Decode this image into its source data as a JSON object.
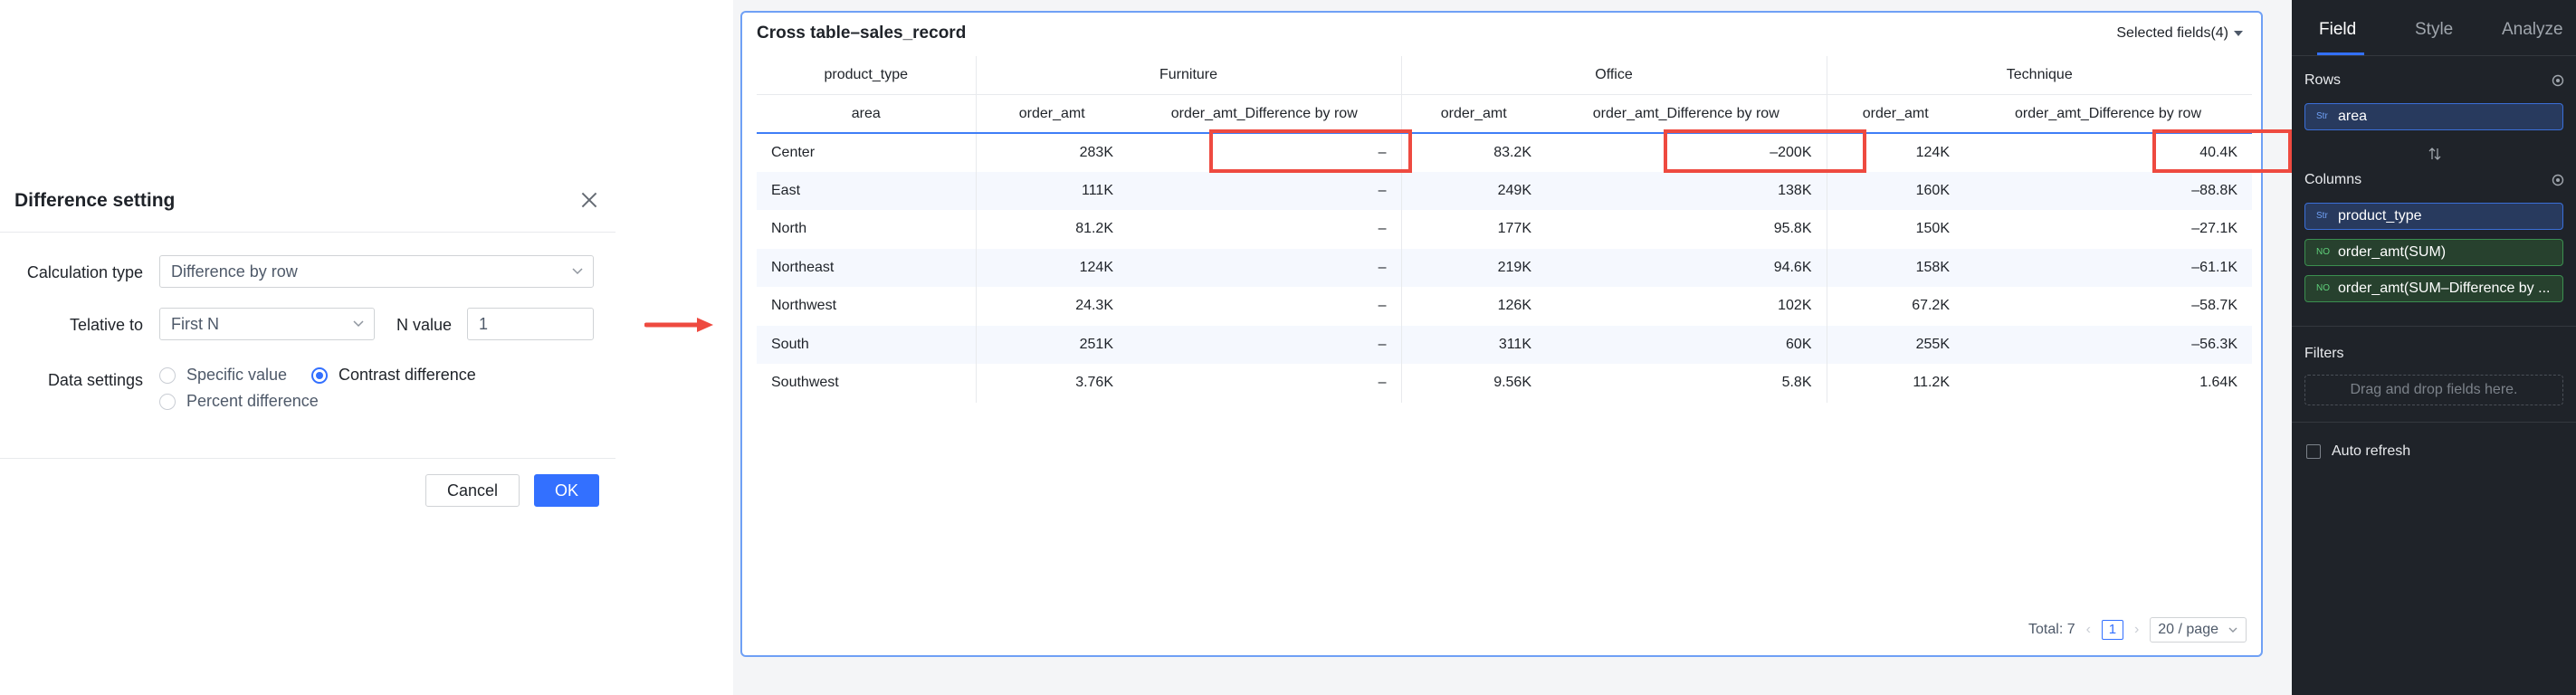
{
  "dialog": {
    "title": "Difference setting",
    "calc_type_label": "Calculation type",
    "calc_type_value": "Difference by row",
    "relative_label": "Telative to",
    "relative_value": "First N",
    "n_label": "N value",
    "n_value": "1",
    "data_settings_label": "Data settings",
    "options": [
      "Specific value",
      "Contrast difference",
      "Percent difference"
    ],
    "selected_option": "Contrast difference",
    "cancel_label": "Cancel",
    "ok_label": "OK"
  },
  "panel": {
    "title": "Cross table–sales_record",
    "selected_fields": "Selected fields(4)"
  },
  "table": {
    "row_dim_label": "product_type",
    "row_header": "area",
    "groups": [
      "Furniture",
      "Office",
      "Technique"
    ],
    "measures": [
      "order_amt",
      "order_amt_Difference by row"
    ],
    "rows": [
      {
        "area": "Center",
        "values": [
          "283K",
          "–",
          "83.2K",
          "–200K",
          "124K",
          "40.4K"
        ]
      },
      {
        "area": "East",
        "values": [
          "111K",
          "–",
          "249K",
          "138K",
          "160K",
          "–88.8K"
        ]
      },
      {
        "area": "North",
        "values": [
          "81.2K",
          "–",
          "177K",
          "95.8K",
          "150K",
          "–27.1K"
        ]
      },
      {
        "area": "Northeast",
        "values": [
          "124K",
          "–",
          "219K",
          "94.6K",
          "158K",
          "–61.1K"
        ]
      },
      {
        "area": "Northwest",
        "values": [
          "24.3K",
          "–",
          "126K",
          "102K",
          "67.2K",
          "–58.7K"
        ]
      },
      {
        "area": "South",
        "values": [
          "251K",
          "–",
          "311K",
          "60K",
          "255K",
          "–56.3K"
        ]
      },
      {
        "area": "Southwest",
        "values": [
          "3.76K",
          "–",
          "9.56K",
          "5.8K",
          "11.2K",
          "1.64K"
        ]
      }
    ]
  },
  "pager": {
    "total": "Total: 7",
    "prev": "‹",
    "page": "1",
    "next": "›",
    "size": "20 / page"
  },
  "sidebar": {
    "tabs": [
      "Field",
      "Style",
      "Analyze"
    ],
    "active_tab": "Field",
    "rows_label": "Rows",
    "row_fields": [
      {
        "icon": "Str",
        "label": "area"
      }
    ],
    "columns_label": "Columns",
    "column_fields": [
      {
        "icon": "Str",
        "label": "product_type"
      },
      {
        "icon": "NO",
        "label": "order_amt(SUM)"
      },
      {
        "icon": "NO",
        "label": "order_amt(SUM–Difference by ..."
      }
    ],
    "filters_label": "Filters",
    "filters_placeholder": "Drag and drop fields here.",
    "auto_refresh_label": "Auto refresh"
  },
  "colors": {
    "accent": "#3370ff",
    "highlight": "#ee4a40",
    "sidebar_bg": "#1f2329"
  }
}
